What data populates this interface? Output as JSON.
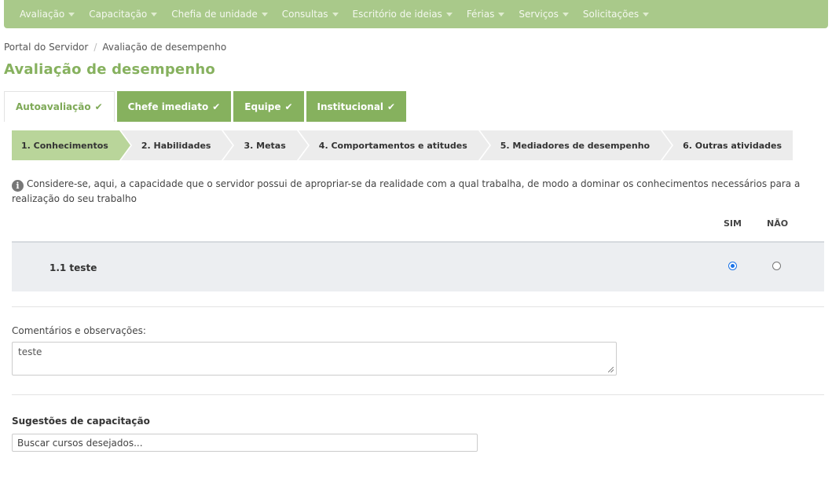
{
  "nav": {
    "items": [
      {
        "label": "Avaliação"
      },
      {
        "label": "Capacitação"
      },
      {
        "label": "Chefia de unidade"
      },
      {
        "label": "Consultas"
      },
      {
        "label": "Escritório de ideias"
      },
      {
        "label": "Férias"
      },
      {
        "label": "Serviços"
      },
      {
        "label": "Solicitações"
      }
    ]
  },
  "breadcrumb": {
    "home": "Portal do Servidor",
    "separator": "/",
    "current": "Avaliação de desempenho"
  },
  "page_title": "Avaliação de desempenho",
  "tabs": [
    {
      "label": "Autoavaliação",
      "check": "✔"
    },
    {
      "label": "Chefe imediato",
      "check": "✔"
    },
    {
      "label": "Equipe",
      "check": "✔"
    },
    {
      "label": "Institucional",
      "check": "✔"
    }
  ],
  "steps": [
    {
      "label": "1. Conhecimentos"
    },
    {
      "label": "2. Habilidades"
    },
    {
      "label": "3. Metas"
    },
    {
      "label": "4. Comportamentos e atitudes"
    },
    {
      "label": "5. Mediadores de desempenho"
    },
    {
      "label": "6. Outras atividades"
    }
  ],
  "info": {
    "icon": "i",
    "text": "Considere-se, aqui, a capacidade que o servidor possui de apropriar-se da realidade com a qual trabalha, de modo a dominar os conhecimentos necessários para a realização do seu trabalho"
  },
  "columns": {
    "yes": "SIM",
    "no": "NÃO"
  },
  "question": {
    "label": "1.1 teste",
    "answer": "SIM"
  },
  "comments": {
    "label": "Comentários e observações:",
    "value": "teste"
  },
  "suggestions": {
    "label": "Sugestões de capacitação",
    "placeholder": "Buscar cursos desejados..."
  },
  "colors": {
    "nav_bg": "#a9c98a",
    "accent": "#86b15e",
    "active_step": "#b9d59a",
    "radio_checked": "#1a73e8"
  }
}
